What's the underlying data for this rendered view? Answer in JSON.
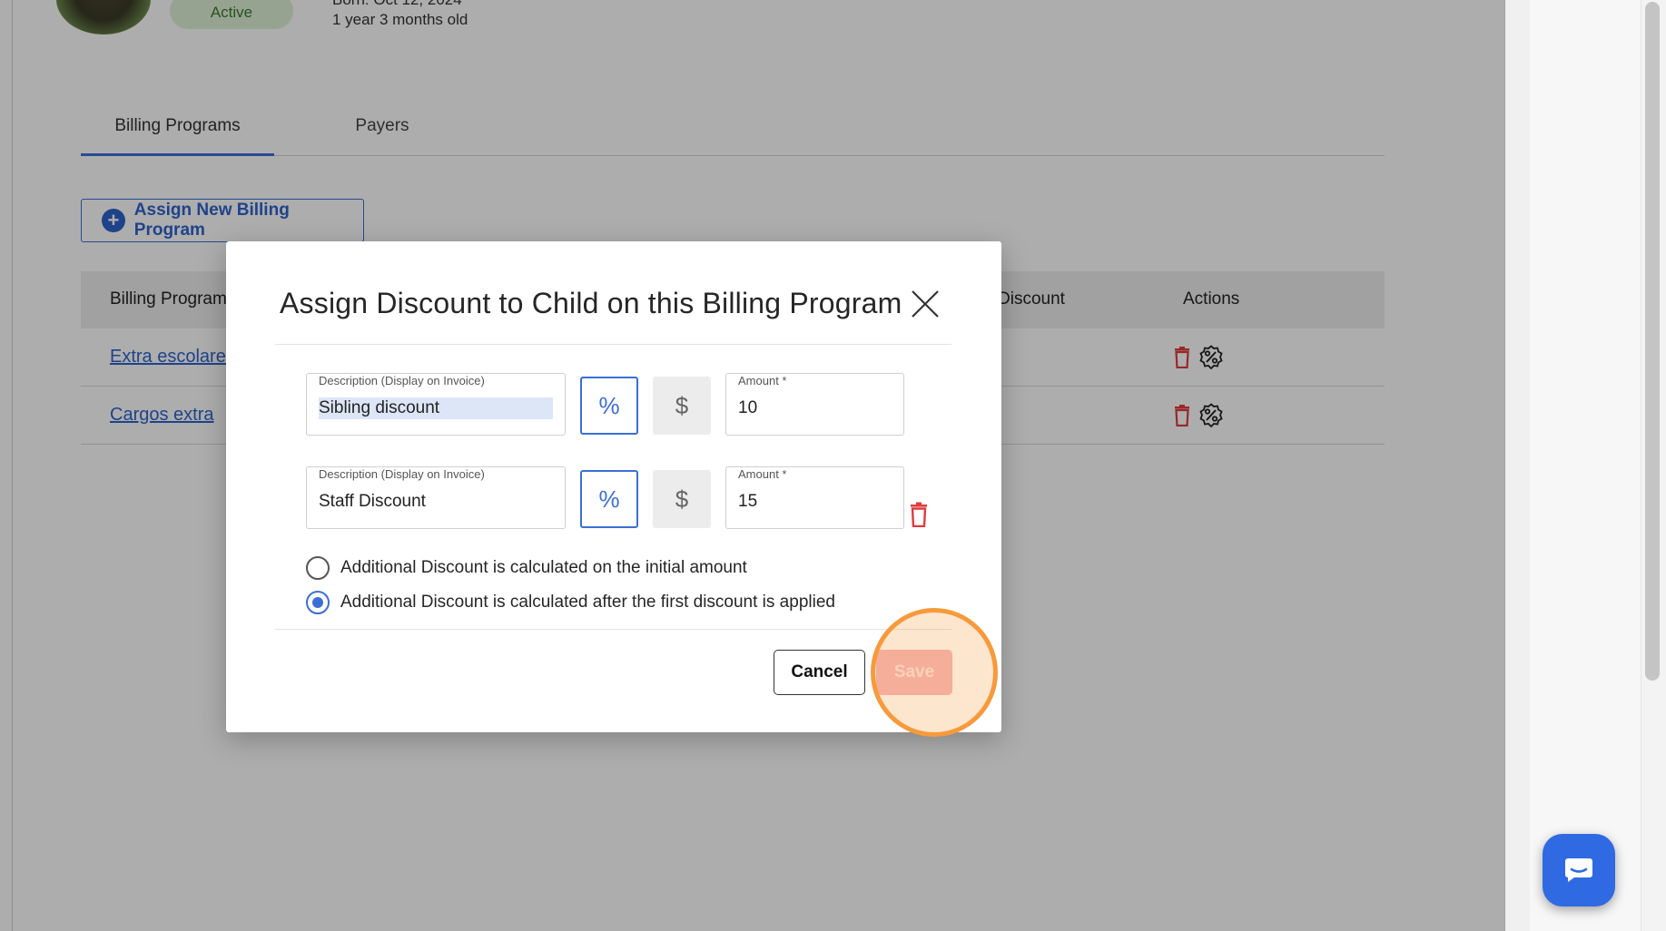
{
  "profile": {
    "status": "Active",
    "born": "Born: Oct 12, 2024",
    "age": "1 year 3 months old"
  },
  "tabs": [
    {
      "label": "Billing Programs",
      "active": true
    },
    {
      "label": "Payers",
      "active": false
    }
  ],
  "assign_button_label": "Assign New Billing Program",
  "table": {
    "headers": {
      "program": "Billing Program",
      "discount": "Discount",
      "actions": "Actions"
    },
    "rows": [
      {
        "program": "Extra escolares"
      },
      {
        "program": "Cargos extra"
      }
    ]
  },
  "modal": {
    "title": "Assign Discount to Child on this Billing Program",
    "discounts": [
      {
        "description_label": "Description (Display on Invoice)",
        "description": "Sibling discount",
        "percent_symbol": "%",
        "dollar_symbol": "$",
        "amount_label": "Amount *",
        "amount": "10"
      },
      {
        "description_label": "Description (Display on Invoice)",
        "description": "Staff Discount",
        "percent_symbol": "%",
        "dollar_symbol": "$",
        "amount_label": "Amount *",
        "amount": "15"
      }
    ],
    "calc_options": [
      {
        "label": "Additional Discount is calculated on the initial amount",
        "checked": false
      },
      {
        "label": "Additional Discount is calculated after the first discount is applied",
        "checked": true
      }
    ],
    "cancel_label": "Cancel",
    "save_label": "Save"
  },
  "colors": {
    "accent": "#3a6fd8",
    "save_disabled": "#f4b5ba",
    "highlight": "#f79a3c",
    "delete": "#e03b3b"
  }
}
